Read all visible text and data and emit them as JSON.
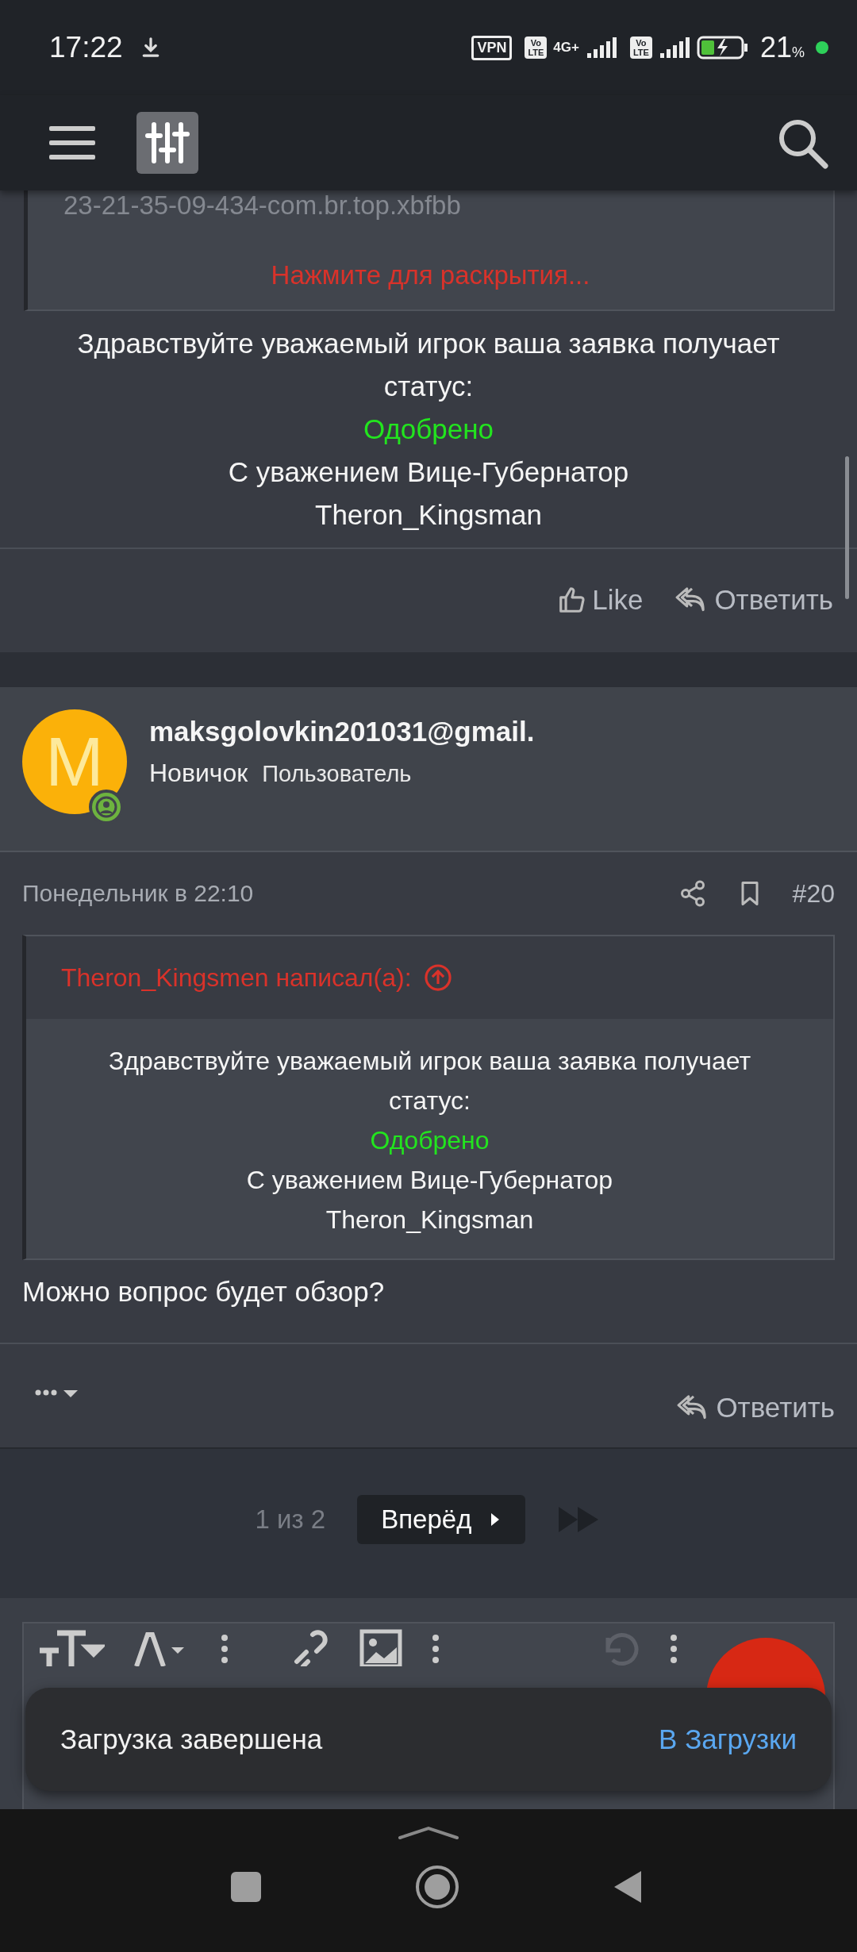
{
  "status_bar": {
    "time": "17:22",
    "vpn": "VPN",
    "network": "4G+",
    "volte_badges": [
      {
        "top": "Vo",
        "bottom": "LTE"
      },
      {
        "top": "Vo",
        "bottom": "LTE"
      }
    ],
    "battery": "21",
    "battery_unit": "%"
  },
  "top_post": {
    "spoiler_text": "23-21-35-09-434-com.br.top.xbfbb",
    "expand_link": "Нажмите для раскрытия...",
    "message": [
      {
        "kind": "text",
        "text": "Здравствуйте уважаемый игрок ваша заявка получает статус:"
      },
      {
        "kind": "approved",
        "text": "Одобрено"
      },
      {
        "kind": "text",
        "text": "С уважением Вице-Губернатор"
      },
      {
        "kind": "text",
        "text": "Theron_Kingsman"
      }
    ],
    "actions": [
      {
        "kind": "like",
        "label": "Like"
      },
      {
        "kind": "reply",
        "label": "Ответить"
      }
    ]
  },
  "post": {
    "avatar_letter": "M",
    "username": "maksgolovkin201031@gmail.",
    "rank": "Новичок",
    "role": "Пользователь",
    "date": "Понедельник в 22:10",
    "number": "#20",
    "quote": {
      "author": "Theron_Kingsmen написал(а):",
      "lines": [
        {
          "kind": "text",
          "text": "Здравствуйте уважаемый игрок ваша заявка получает статус:"
        },
        {
          "kind": "approved",
          "text": "Одобрено"
        },
        {
          "kind": "text",
          "text": "С уважением Вице-Губернатор"
        },
        {
          "kind": "text",
          "text": "Theron_Kingsman"
        }
      ]
    },
    "body": "Можно вопрос будет обзор?",
    "reply": "Ответить"
  },
  "pagination": {
    "page": "1 из 2",
    "next": "Вперёд"
  },
  "snackbar": {
    "message": "Загрузка завершена",
    "action": "В Загрузки"
  }
}
